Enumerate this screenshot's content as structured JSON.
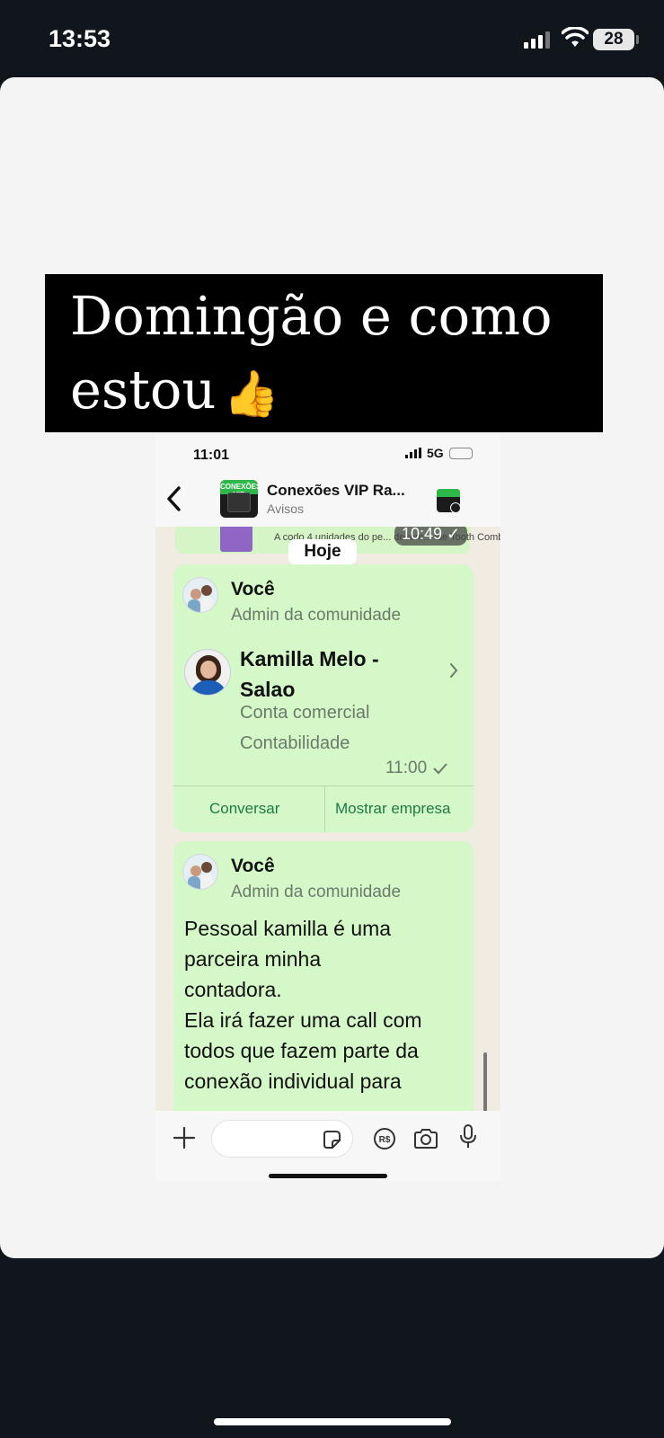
{
  "status_bar": {
    "time": "13:53",
    "battery": "28"
  },
  "story": {
    "caption_line1": "Domingão e como",
    "caption_line2": "estou",
    "caption_emoji": "👍"
  },
  "phone": {
    "time": "11:01",
    "network": "5G",
    "header": {
      "title": "Conexões VIP Ra...",
      "subtitle": "Avisos",
      "avatar_label": "CONEXÕES VIP"
    },
    "previous_message": {
      "text": "A codo 4 unidades do pe... desem... ide Tooth Comb",
      "time": "10:49 ✓"
    },
    "day_label": "Hoje",
    "contact_message": {
      "sender": "Você",
      "sender_role": "Admin da comunidade",
      "contact_name": "Kamilla Melo - Salao",
      "contact_type": "Conta comercial",
      "contact_category": "Contabilidade",
      "time": "11:00",
      "action_chat": "Conversar",
      "action_business": "Mostrar empresa"
    },
    "text_message": {
      "sender": "Você",
      "sender_role": "Admin da comunidade",
      "body": "Pessoal kamilla é uma\nparceira minha\ncontadora.\nEla irá fazer uma call com\ntodos que fazem parte da\nconexão individual para"
    },
    "input": {
      "pay_label": "R$"
    }
  },
  "colors": {
    "bubble": "#d5f8c8",
    "accent_green": "#1d7a45",
    "caption_bg": "#000000"
  }
}
